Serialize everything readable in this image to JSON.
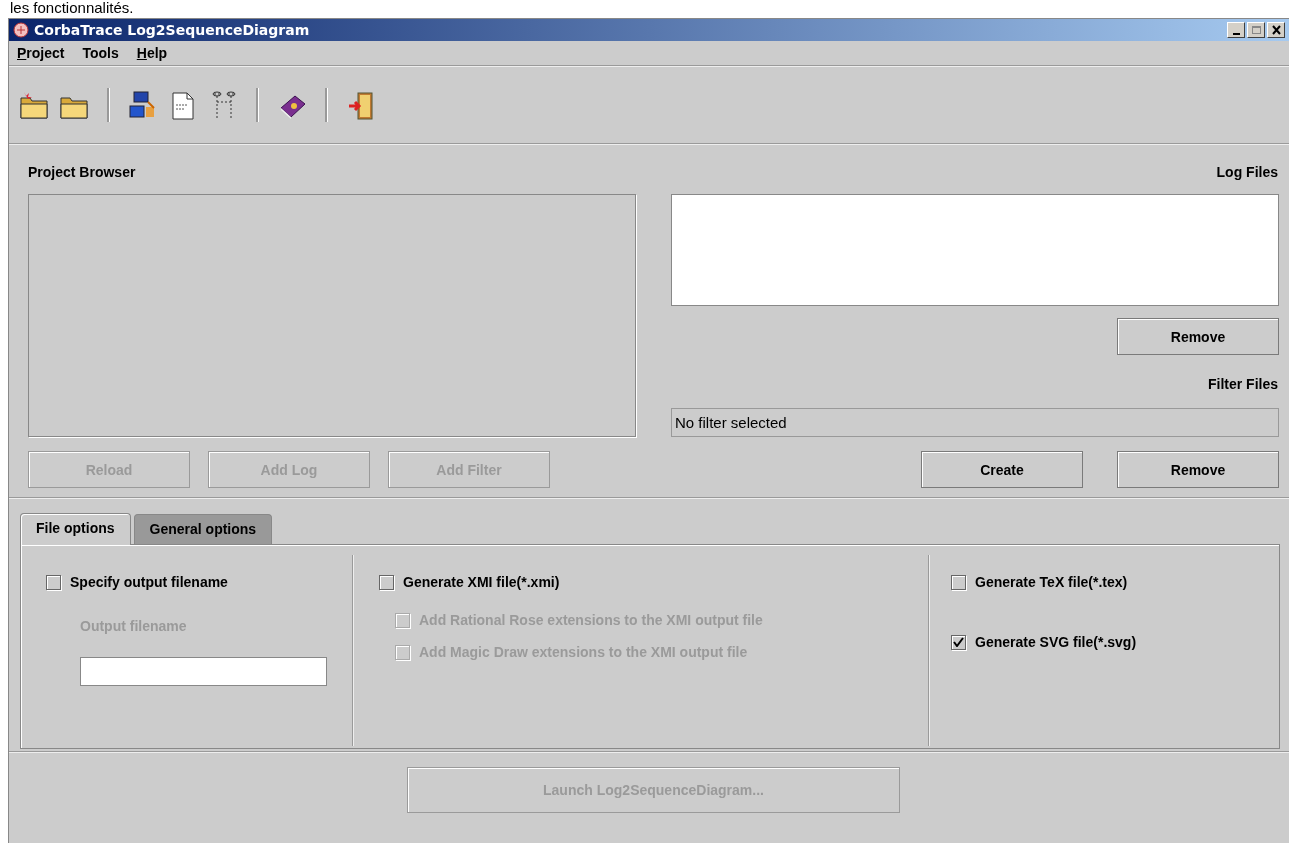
{
  "caption": "les fonctionnalités.",
  "window": {
    "title": "CorbaTrace Log2SequenceDiagram"
  },
  "menu": [
    {
      "label": "Project",
      "mnemonic": true
    },
    {
      "label": "Tools",
      "mnemonic": false
    },
    {
      "label": "Help",
      "mnemonic": true
    }
  ],
  "project_browser": {
    "title": "Project Browser",
    "buttons": [
      {
        "label": "Reload",
        "disabled": true
      },
      {
        "label": "Add Log",
        "disabled": true
      },
      {
        "label": "Add Filter",
        "disabled": true
      }
    ]
  },
  "log_files": {
    "title": "Log Files",
    "buttons": [
      {
        "label": "Remove",
        "disabled": false
      }
    ]
  },
  "filter_files": {
    "title": "Filter Files",
    "value": "No filter selected",
    "buttons": [
      {
        "label": "Create",
        "disabled": false
      },
      {
        "label": "Remove",
        "disabled": false
      }
    ]
  },
  "tabs": [
    {
      "label": "File options",
      "selected": true
    },
    {
      "label": "General options",
      "selected": false
    }
  ],
  "file_options": [
    {
      "items": [
        {
          "kind": "checkbox",
          "label": "Specify output filename",
          "checked": false,
          "disabled": false
        },
        {
          "kind": "label",
          "label": "Output filename",
          "disabled": true
        },
        {
          "kind": "field",
          "disabled": false
        }
      ]
    },
    {
      "items": [
        {
          "kind": "checkbox",
          "label": "Generate XMI file(*.xmi)",
          "checked": false,
          "disabled": false
        },
        {
          "kind": "subcheckbox",
          "label": "Add Rational Rose extensions to the XMI output file",
          "checked": false,
          "disabled": true
        },
        {
          "kind": "subcheckbox",
          "label": "Add Magic Draw extensions to the XMI output file",
          "checked": false,
          "disabled": true
        }
      ]
    },
    {
      "items": [
        {
          "kind": "checkbox",
          "label": "Generate TeX file(*.tex)",
          "checked": false,
          "disabled": false
        },
        {
          "kind": "checkbox",
          "label": "Generate SVG file(*.svg)",
          "checked": true,
          "disabled": false
        }
      ]
    }
  ],
  "launch_button": {
    "label": "Launch Log2SequenceDiagram...",
    "disabled": true
  }
}
